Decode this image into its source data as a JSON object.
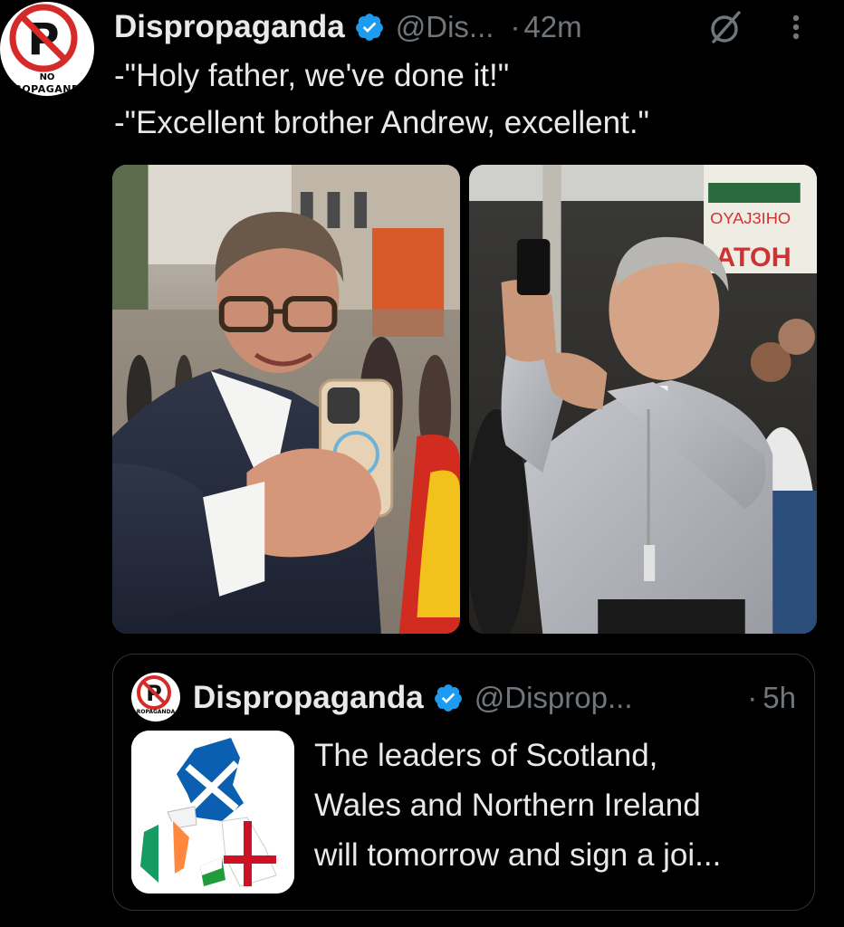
{
  "post": {
    "display_name": "Dispropaganda",
    "handle": "@Dis...",
    "separator": "·",
    "time": "42m",
    "avatar_text_top": "NO",
    "avatar_text_bottom": "ROPAGAND",
    "verified_icon": "verified-badge-icon",
    "grok_icon": "grok-icon",
    "more_icon": "more-options-icon",
    "text_lines": [
      "-\"Holy father, we've done it!\"",
      "-\"Excellent brother Andrew, excellent.\""
    ],
    "media": [
      {
        "name": "photo-man-in-navy-suit-taking-selfie"
      },
      {
        "name": "photo-priest-taking-photo-with-phone"
      }
    ]
  },
  "quote": {
    "display_name": "Dispropaganda",
    "handle": "@Disprop...",
    "separator": "·",
    "time": "5h",
    "avatar_text_top": "NO",
    "avatar_text_bottom": "ROPAGANDA",
    "text_lines": [
      "The leaders of Scotland,",
      "Wales and Northern Ireland",
      "will tomorrow and sign a joi..."
    ]
  },
  "colors": {
    "background": "#000000",
    "primary_text": "#e7e9ea",
    "secondary_text": "#71767b",
    "verified": "#1d9bf0",
    "border": "#2f3336"
  }
}
